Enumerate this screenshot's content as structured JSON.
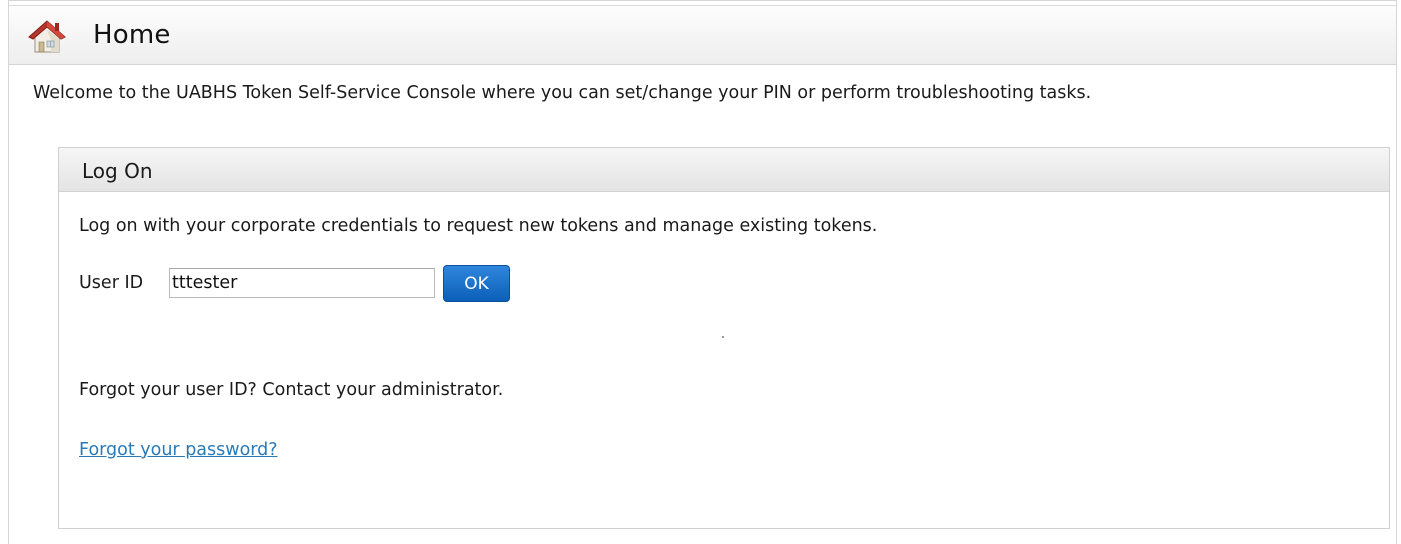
{
  "header": {
    "title": "Home",
    "icon": "home-icon"
  },
  "welcome_text": "Welcome to the UABHS Token Self-Service Console where you can set/change your PIN or perform troubleshooting tasks.",
  "logon_panel": {
    "title": "Log On",
    "instructions": "Log on with your corporate credentials to request new tokens and manage existing tokens.",
    "user_id_label": "User ID",
    "user_id_value": "tttester",
    "ok_label": "OK",
    "forgot_user_id_text": "Forgot your user ID? Contact your administrator.",
    "forgot_password_link": "Forgot your password?"
  },
  "colors": {
    "ok_button": "#1a6fca",
    "link": "#2a7ab8"
  }
}
